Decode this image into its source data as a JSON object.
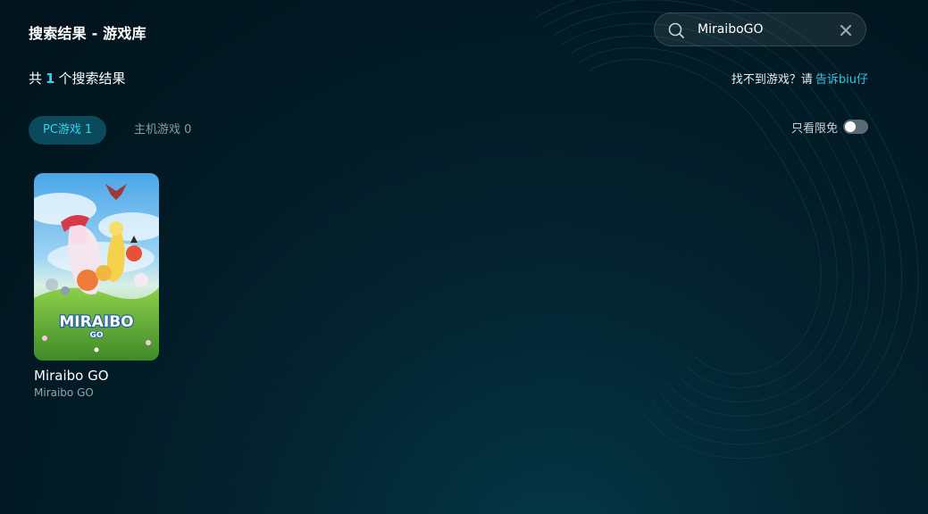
{
  "header": {
    "title": "搜索结果 - 游戏库"
  },
  "search": {
    "value": "MiraiboGO"
  },
  "results": {
    "prefix": "共",
    "count": "1",
    "suffix": "个搜索结果"
  },
  "feedback": {
    "text": "找不到游戏？请",
    "link": "告诉biu仔"
  },
  "tabs": [
    {
      "label": "PC游戏 1",
      "active": true
    },
    {
      "label": "主机游戏 0",
      "active": false
    }
  ],
  "filter": {
    "free_label": "只看限免",
    "free_only": false
  },
  "games": [
    {
      "name": "Miraibo GO",
      "subtitle": "Miraibo GO",
      "cover_logo": "MIRAIBO",
      "cover_logo_sub": "GO"
    }
  ],
  "colors": {
    "accent": "#2fd5f0",
    "tab_active_bg": "#0b4a5c",
    "link": "#2bc9e8"
  }
}
